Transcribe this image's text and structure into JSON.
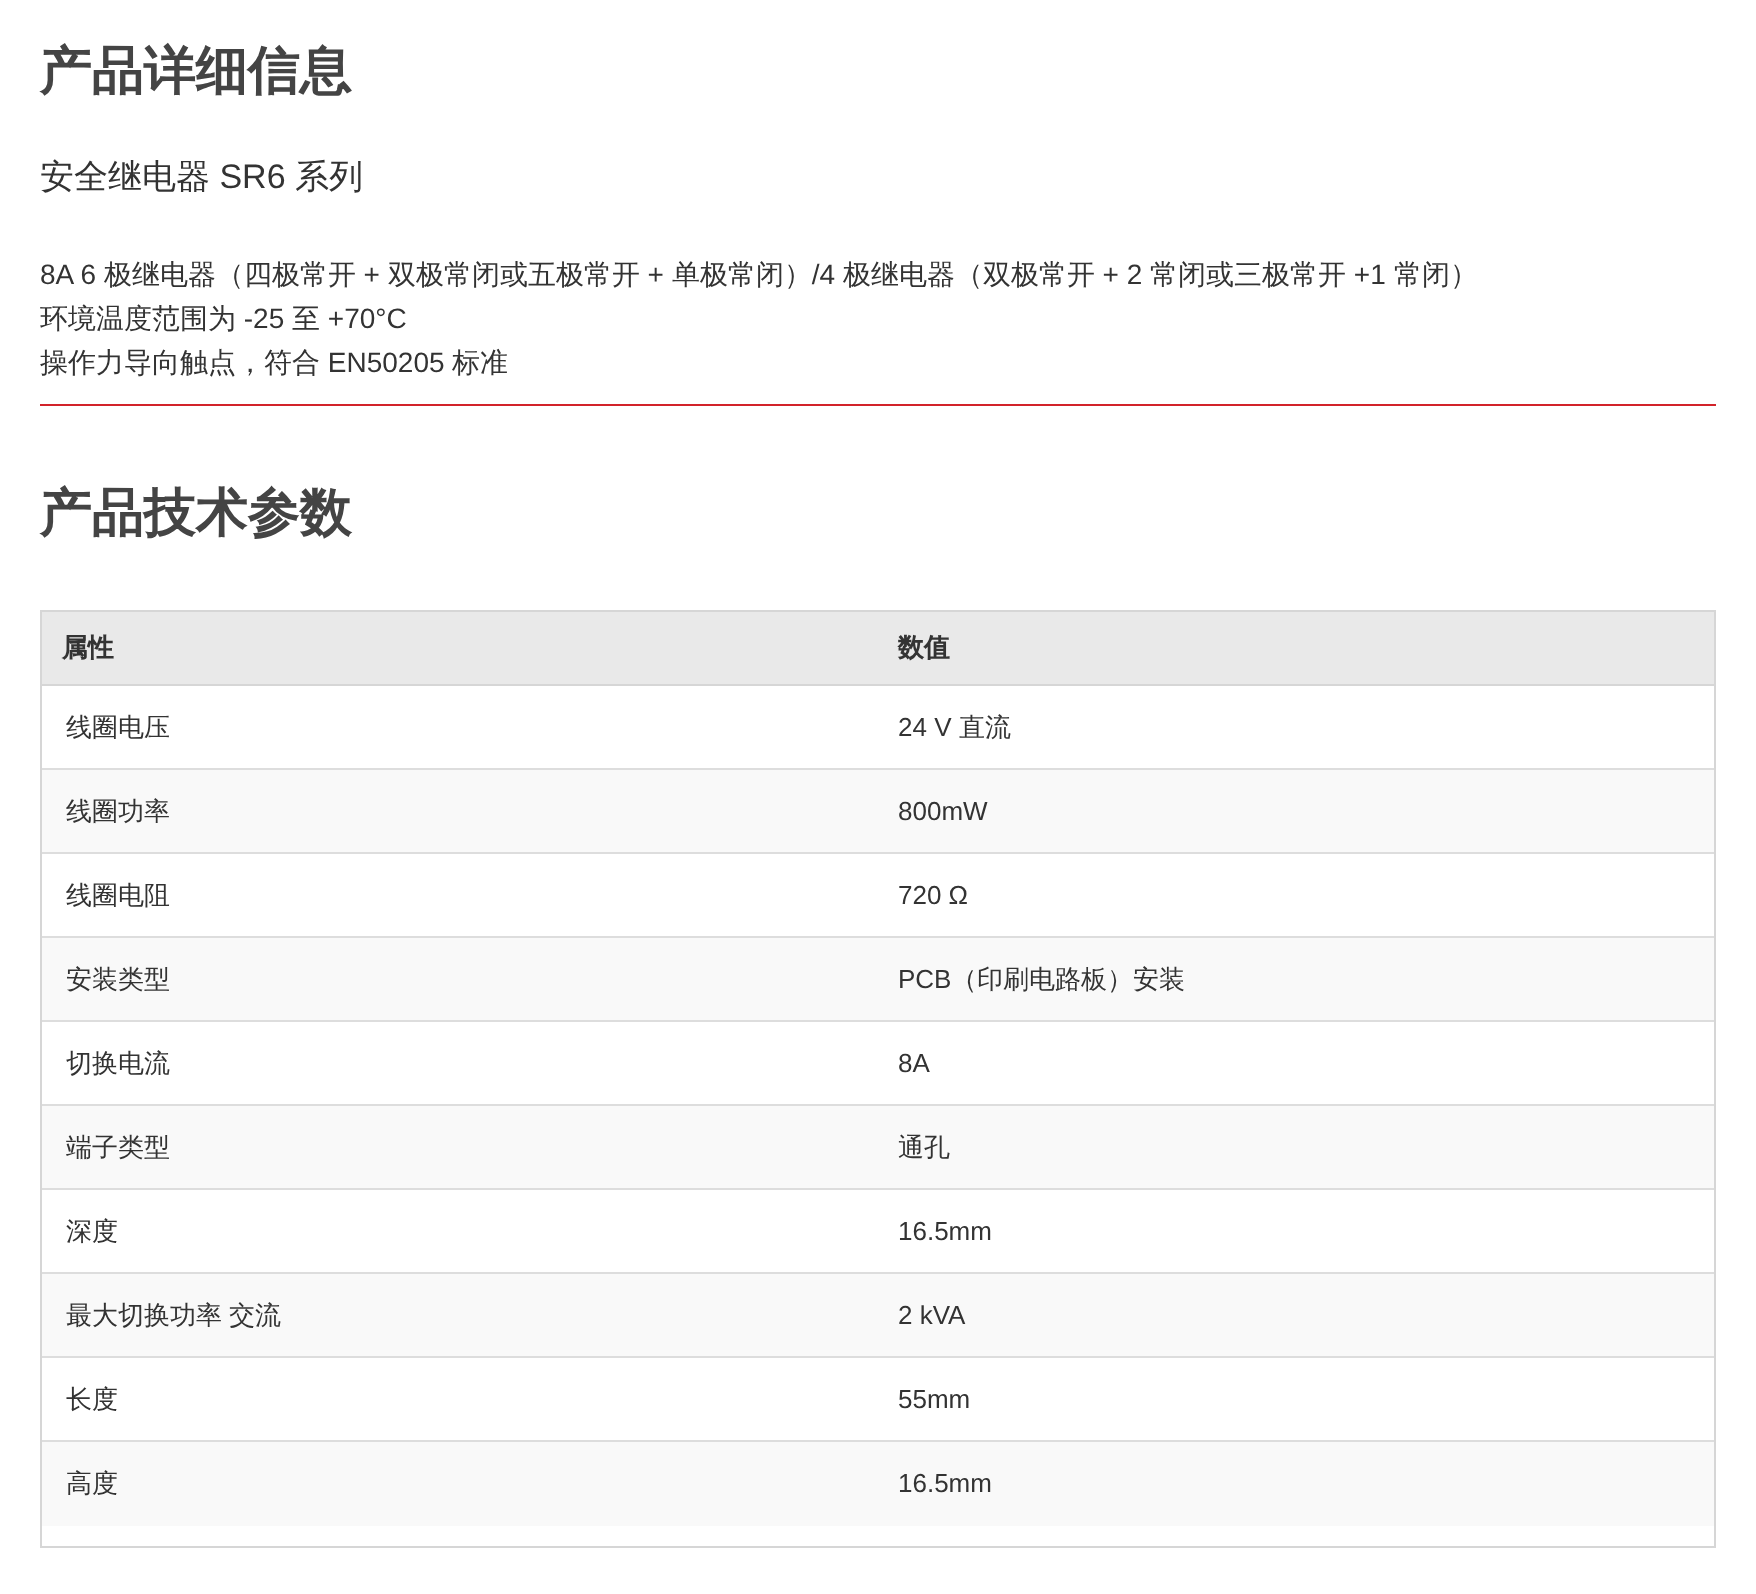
{
  "details": {
    "heading": "产品详细信息",
    "subtitle": "安全继电器 SR6 系列",
    "lines": [
      "8A 6 极继电器（四极常开 + 双极常闭或五极常开 + 单极常闭）/4 极继电器（双极常开 + 2 常闭或三极常开 +1 常闭）",
      "环境温度范围为 -25 至 +70°C",
      "操作力导向触点，符合 EN50205 标准"
    ]
  },
  "specs": {
    "heading": "产品技术参数",
    "columns": [
      "属性",
      "数值"
    ],
    "rows": [
      [
        "线圈电压",
        "24 V 直流"
      ],
      [
        "线圈功率",
        "800mW"
      ],
      [
        "线圈电阻",
        "720 Ω"
      ],
      [
        "安装类型",
        "PCB（印刷电路板）安装"
      ],
      [
        "切换电流",
        "8A"
      ],
      [
        "端子类型",
        "通孔"
      ],
      [
        "深度",
        "16.5mm"
      ],
      [
        "最大切换功率 交流",
        "2 kVA"
      ],
      [
        "长度",
        "55mm"
      ],
      [
        "高度",
        "16.5mm"
      ]
    ]
  }
}
